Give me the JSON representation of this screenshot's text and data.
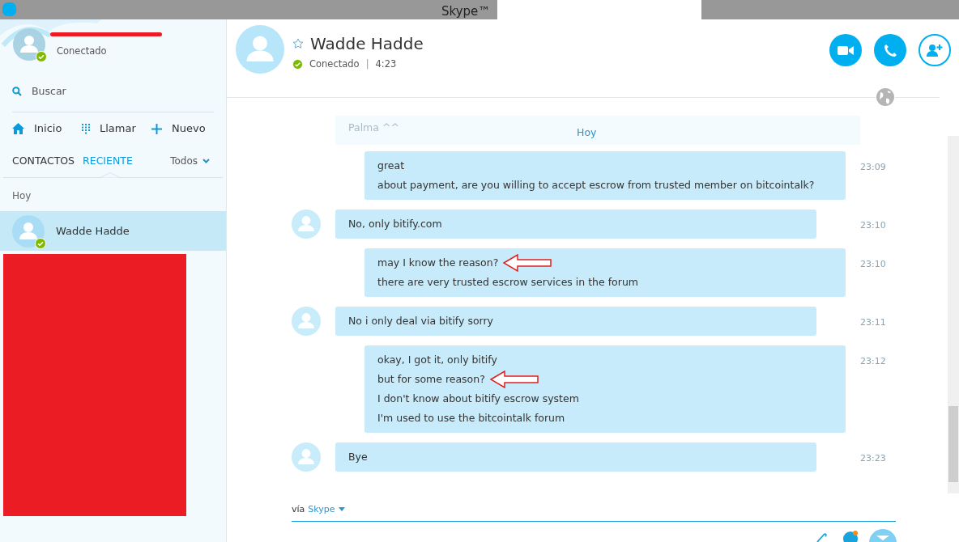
{
  "window": {
    "title": "Skype™"
  },
  "profile": {
    "status": "Conectado"
  },
  "search": {
    "placeholder": "Buscar"
  },
  "nav": [
    {
      "label": "Inicio",
      "kind": "home"
    },
    {
      "label": "Llamar",
      "kind": "dialpad"
    },
    {
      "label": "Nuevo",
      "kind": "plus"
    }
  ],
  "tabs": [
    {
      "label": "CONTACTOS",
      "selected": false
    },
    {
      "label": "RECIENTE",
      "selected": true
    }
  ],
  "filter": {
    "label": "Todos"
  },
  "recent": {
    "group": "Hoy",
    "items": [
      {
        "name": "Wadde Hadde",
        "selected": true
      }
    ]
  },
  "chat": {
    "name": "Wadde Hadde",
    "status": "Conectado",
    "separator": "|",
    "duration": "4:23"
  },
  "history": {
    "faded_message": "Palma ^^",
    "day": "Hoy"
  },
  "messages": [
    {
      "kind": "outgoing",
      "time": "23:09",
      "lines": [
        {
          "text": "great",
          "marked": false
        },
        {
          "text": "about payment, are you willing to accept escrow from trusted member on bitcointalk?",
          "marked": false
        }
      ]
    },
    {
      "kind": "incoming",
      "time": "23:10",
      "lines": [
        {
          "text": "No, only bitify.com",
          "marked": false
        }
      ]
    },
    {
      "kind": "outgoing",
      "time": "23:10",
      "lines": [
        {
          "text": "may I know the reason?",
          "marked": true
        },
        {
          "text": "there are very trusted escrow services in the forum",
          "marked": false
        }
      ]
    },
    {
      "kind": "incoming",
      "time": "23:11",
      "lines": [
        {
          "text": "No i only deal via bitify sorry",
          "marked": false
        }
      ]
    },
    {
      "kind": "outgoing",
      "time": "23:12",
      "lines": [
        {
          "text": "okay, I got it, only bitify",
          "marked": false
        },
        {
          "text": "but for some reason?",
          "marked": true
        },
        {
          "text": "I don't know about bitify escrow system",
          "marked": false
        },
        {
          "text": "I'm used to use the bitcointalk forum",
          "marked": false
        }
      ]
    },
    {
      "kind": "incoming",
      "time": "23:23",
      "lines": [
        {
          "text": "Bye",
          "marked": false
        }
      ]
    }
  ],
  "compose": {
    "via": "vía",
    "service": "Skype"
  }
}
